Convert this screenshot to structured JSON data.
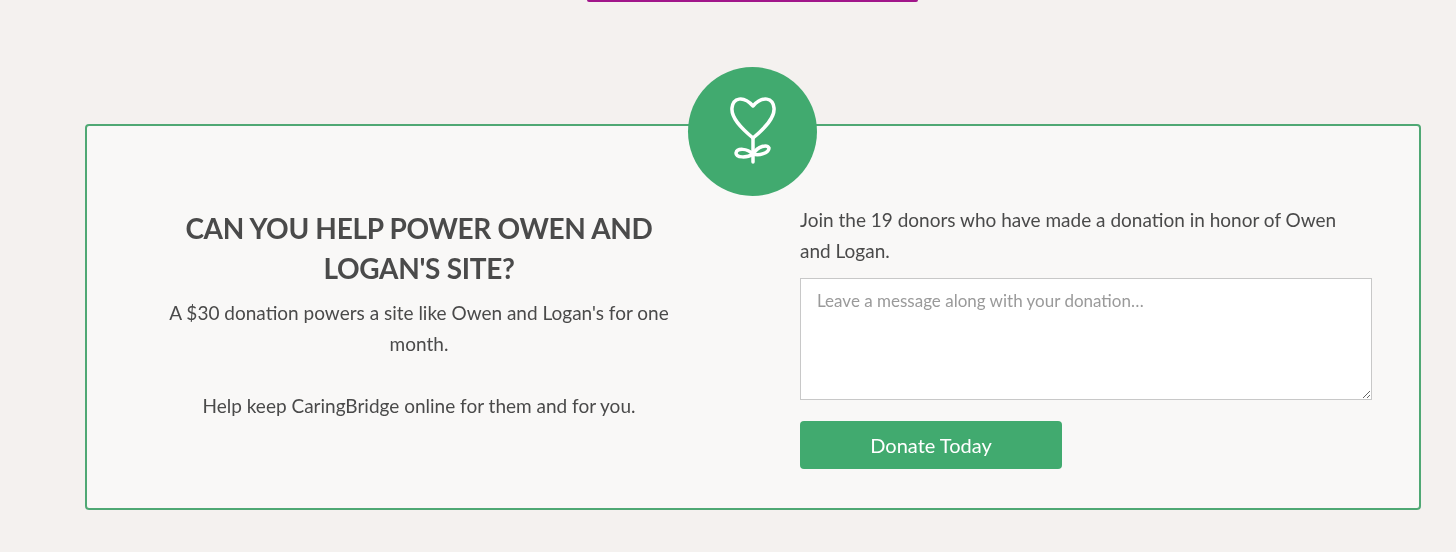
{
  "heading": "CAN YOU HELP POWER OWEN AND LOGAN'S SITE?",
  "paragraphs": [
    "A $30 donation powers a site like Owen and Logan's for one month.",
    "Help keep CaringBridge online for them and for you."
  ],
  "intro": "Join the 19 donors who have made a donation in honor of Owen and Logan.",
  "message": {
    "placeholder": "Leave a message along with your donation…"
  },
  "donate_button": "Donate Today"
}
